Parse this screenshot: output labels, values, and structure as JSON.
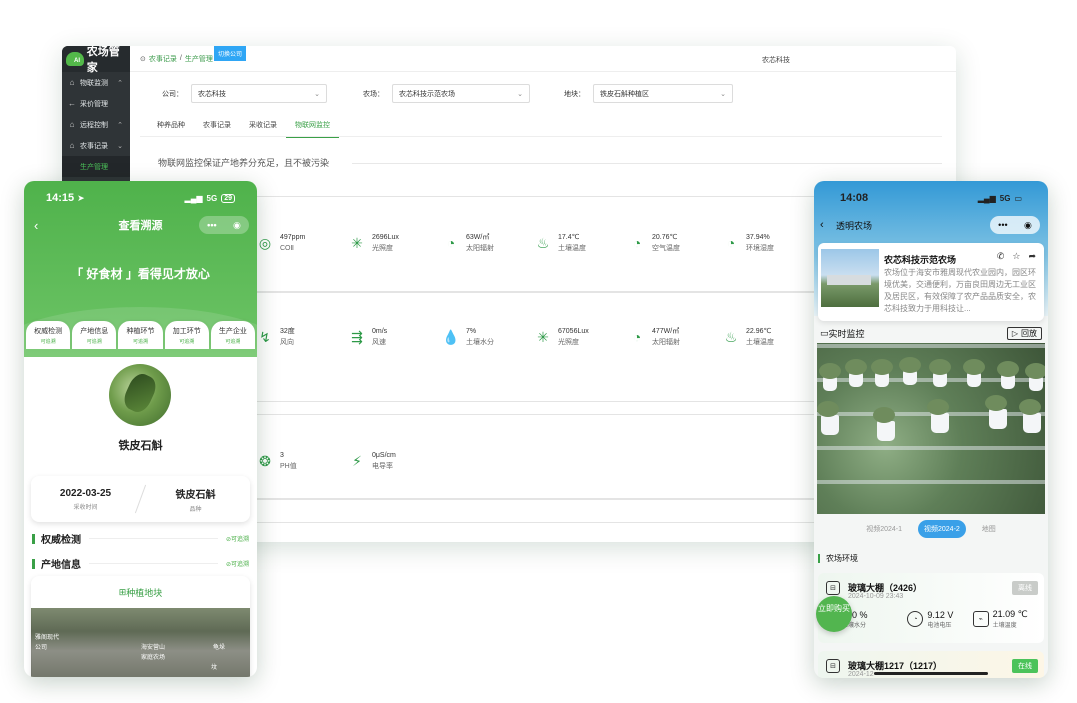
{
  "admin": {
    "logo_text": "农场管家",
    "logo_mark": "AI",
    "sidebar": [
      {
        "label": "物联监测",
        "icon": "home-icon",
        "arrow": "^"
      },
      {
        "label": "采价管理",
        "icon": "back-arrow-icon",
        "arrow": ""
      },
      {
        "label": "远程控制",
        "icon": "home-icon",
        "arrow": "^"
      },
      {
        "label": "农事记录",
        "icon": "home-icon",
        "arrow": "v"
      },
      {
        "label": "生产管理",
        "icon": "",
        "arrow": ""
      }
    ],
    "breadcrumb": [
      "农事记录",
      "生产管理"
    ],
    "switch_label": "切换公司",
    "company_name": "农芯科技",
    "filters": {
      "company_label": "公司：",
      "company_value": "农芯科技",
      "farm_label": "农场：",
      "farm_value": "农芯科技示范农场",
      "plot_label": "地块：",
      "plot_value": "铁皮石斛种植区"
    },
    "tabs": [
      "种养品种",
      "农事记录",
      "采收记录",
      "物联网监控"
    ],
    "active_tab": 3,
    "notice": "物联网监控保证产地养分充足，且不被污染",
    "row1": [
      {
        "value": "497ppm",
        "label": "COⅡ",
        "icon": "co2-icon",
        "glyph": "◎"
      },
      {
        "value": "2696Lux",
        "label": "光照度",
        "icon": "sun-icon",
        "glyph": "✳"
      },
      {
        "value": "63W/㎡",
        "label": "太阳辐射",
        "icon": "gauge-icon",
        "glyph": "◔"
      },
      {
        "value": "17.4℃",
        "label": "土壤温度",
        "icon": "soil-temp-icon",
        "glyph": "♨"
      },
      {
        "value": "20.76℃",
        "label": "空气温度",
        "icon": "gauge-icon",
        "glyph": "◔"
      },
      {
        "value": "37.94%",
        "label": "环境湿度",
        "icon": "gauge-icon",
        "glyph": "◔"
      }
    ],
    "row2": [
      {
        "value": "32度",
        "label": "风向",
        "icon": "wind-direction-icon",
        "glyph": "↯"
      },
      {
        "value": "0m/s",
        "label": "风速",
        "icon": "windsock-icon",
        "glyph": "⇶"
      },
      {
        "value": "7%",
        "label": "土壤水分",
        "icon": "soil-moisture-icon",
        "glyph": "💧"
      },
      {
        "value": "67056Lux",
        "label": "光照度",
        "icon": "sun-icon",
        "glyph": "✳"
      },
      {
        "value": "477W/㎡",
        "label": "太阳辐射",
        "icon": "gauge-icon",
        "glyph": "◔"
      },
      {
        "value": "22.96℃",
        "label": "土壤温度",
        "icon": "soil-temp-icon",
        "glyph": "♨"
      }
    ],
    "row3": [
      {
        "value": "3",
        "label": "PH值",
        "icon": "ph-icon",
        "glyph": "❂"
      },
      {
        "value": "0μS/cm",
        "label": "电导率",
        "icon": "conductivity-icon",
        "glyph": "⚡"
      }
    ]
  },
  "phone_left": {
    "time": "14:15",
    "network": "5G",
    "battery": "29",
    "title": "查看溯源",
    "slogan": "「 好食材 」看得见才放心",
    "steps": [
      {
        "name": "权威检测",
        "status": "可追溯"
      },
      {
        "name": "产地信息",
        "status": "可追溯"
      },
      {
        "name": "种植环节",
        "status": "可追溯"
      },
      {
        "name": "加工环节",
        "status": "可追溯"
      },
      {
        "name": "生产企业",
        "status": "可追溯"
      }
    ],
    "product_name": "铁皮石斛",
    "harvest_date": "2022-03-25",
    "harvest_label": "采收时间",
    "variety": "铁皮石斛",
    "variety_label": "品种",
    "sections": [
      {
        "title": "权威检测",
        "trace": "⊘可追溯"
      },
      {
        "title": "产地信息",
        "trace": "⊘可追溯"
      }
    ],
    "plot_title": "种植地块",
    "map_labels": [
      "雅阁现代",
      "公司",
      "海安营山",
      "家庭农场",
      "龟垛",
      "坟"
    ]
  },
  "phone_right": {
    "time": "14:08",
    "network": "5G",
    "nav_title": "透明农场",
    "farm_name": "农芯科技示范农场",
    "farm_desc": "农场位于海安市雅周现代农业园内，园区环境优美，交通便利，万亩良田周边无工业区及居民区，有效保障了农产品品质安全，农芯科技致力于用科技让...",
    "monitor_title": "实时监控",
    "replay": "回放",
    "video_tabs": [
      "视频2024-1",
      "视频2024-2",
      "地图"
    ],
    "active_video_tab": 1,
    "env_title": "农场环境",
    "buy_label": "立即购买",
    "cards": [
      {
        "name": "玻璃大棚（2426）",
        "time": "2024-10-09 23:43",
        "status": "离线",
        "status_color": "#c9ccc9",
        "values": [
          {
            "value": "100 %",
            "label": "土壤水分",
            "icon": "soil-moisture-icon"
          },
          {
            "value": "9.12 V",
            "label": "电池电压",
            "icon": "gauge-icon"
          },
          {
            "value": "21.09 ℃",
            "label": "土壤温度",
            "icon": "soil-temp-icon"
          }
        ]
      },
      {
        "name": "玻璃大棚1217（1217）",
        "time": "2024-12-",
        "status": "在线",
        "status_color": "#4cc35a"
      }
    ]
  },
  "colors": {
    "brand_green": "#3aa047",
    "header_green": "#4fb24b",
    "blue": "#3399d6"
  }
}
